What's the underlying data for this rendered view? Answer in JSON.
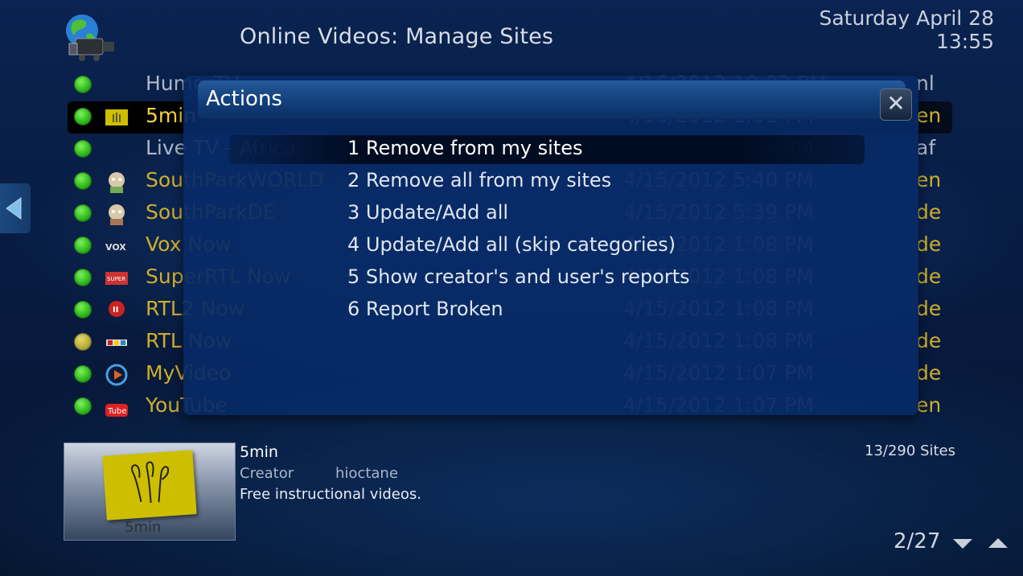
{
  "header": {
    "title": "Online Videos: Manage Sites",
    "date": "Saturday April 28",
    "time": "13:55"
  },
  "sites": [
    {
      "name": "HumorTV",
      "date": "4/16/2012 10:02 PM",
      "lang": "nl",
      "status": "green",
      "selected": false,
      "white": true
    },
    {
      "name": "5min",
      "date": "4/16/2012 1:01 PM",
      "lang": "en",
      "status": "green",
      "selected": true,
      "white": false
    },
    {
      "name": "Live TV - Africa",
      "date": "4/15/2012 6:04 PM",
      "lang": "af",
      "status": "green",
      "selected": false,
      "white": true
    },
    {
      "name": "SouthParkWORLD",
      "date": "4/15/2012 5:40 PM",
      "lang": "en",
      "status": "green",
      "selected": false,
      "white": false
    },
    {
      "name": "SouthParkDE",
      "date": "4/15/2012 5:39 PM",
      "lang": "de",
      "status": "green",
      "selected": false,
      "white": false
    },
    {
      "name": "Vox Now",
      "date": "4/15/2012 1:08 PM",
      "lang": "de",
      "status": "green",
      "selected": false,
      "white": false
    },
    {
      "name": "SuperRTL Now",
      "date": "4/15/2012 1:08 PM",
      "lang": "de",
      "status": "green",
      "selected": false,
      "white": false
    },
    {
      "name": "RTL2 Now",
      "date": "4/15/2012 1:08 PM",
      "lang": "de",
      "status": "green",
      "selected": false,
      "white": false
    },
    {
      "name": "RTL Now",
      "date": "4/15/2012 1:08 PM",
      "lang": "de",
      "status": "yellow",
      "selected": false,
      "white": false
    },
    {
      "name": "MyVideo",
      "date": "4/15/2012 1:07 PM",
      "lang": "de",
      "status": "green",
      "selected": false,
      "white": false
    },
    {
      "name": "YouTube",
      "date": "4/15/2012 1:07 PM",
      "lang": "en",
      "status": "green",
      "selected": false,
      "white": false
    }
  ],
  "dialog": {
    "title": "Actions",
    "items": [
      "1 Remove from my sites",
      "2 Remove all from my sites",
      "3 Update/Add all",
      "4 Update/Add all (skip categories)",
      "5 Show creator's and user's reports",
      "6 Report Broken"
    ]
  },
  "info": {
    "name": "5min",
    "creator_label": "Creator",
    "creator": "hioctane",
    "description": "Free instructional videos.",
    "thumb_label": "5min",
    "site_count": "13/290 Sites",
    "page": "2/27"
  }
}
